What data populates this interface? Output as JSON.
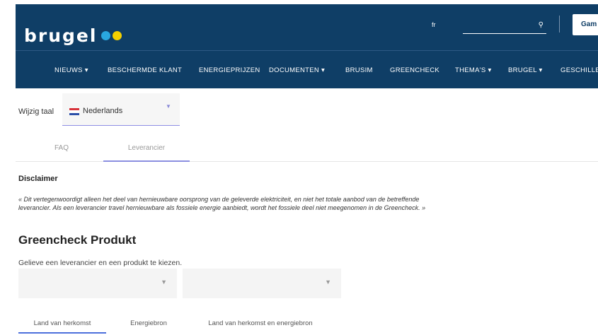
{
  "header": {
    "logo_text": "brugel",
    "logo_dot_colors": [
      "#29a8e0",
      "#f5d000"
    ],
    "lang_short": "fr",
    "search_icon": "search-icon",
    "login_label": "Gam",
    "nav": [
      "NIEUWS ▾",
      "BESCHERMDE KLANT",
      "ENERGIEPRIJZEN",
      "DOCUMENTEN ▾",
      "BRUSIM",
      "GREENCHECK",
      "THEMA'S ▾",
      "BRUGEL ▾",
      "GESCHILLEN"
    ]
  },
  "language": {
    "label": "Wijzig taal",
    "value": "Nederlands"
  },
  "tabs": [
    {
      "label": "FAQ",
      "active": false
    },
    {
      "label": "Leverancier",
      "active": true
    }
  ],
  "disclaimer": {
    "title": "Disclaimer",
    "text": "« Dit vertegenwoordigt alleen het deel van hernieuwbare oorsprong van de geleverde elektriciteit, en niet het totale aanbod van de betreffende leverancier. Als een leverancier travel hernieuwbare als fossiele energie aanbiedt, wordt het fossiele deel niet meegenomen in de Greencheck. »"
  },
  "greencheck": {
    "title": "Greencheck Produkt",
    "subtitle": "Gelieve een leverancier en een produkt te kiezen.",
    "select1_value": "",
    "select2_value": "",
    "tabs": [
      {
        "label": "Land van herkomst",
        "active": true
      },
      {
        "label": "Energiebron",
        "active": false
      },
      {
        "label": "Land van herkomst en energiebron",
        "active": false
      }
    ]
  },
  "colors": {
    "header_bg": "#0f3e66",
    "accent": "#8b8fe0",
    "active_tab": "#4c6fdc"
  }
}
